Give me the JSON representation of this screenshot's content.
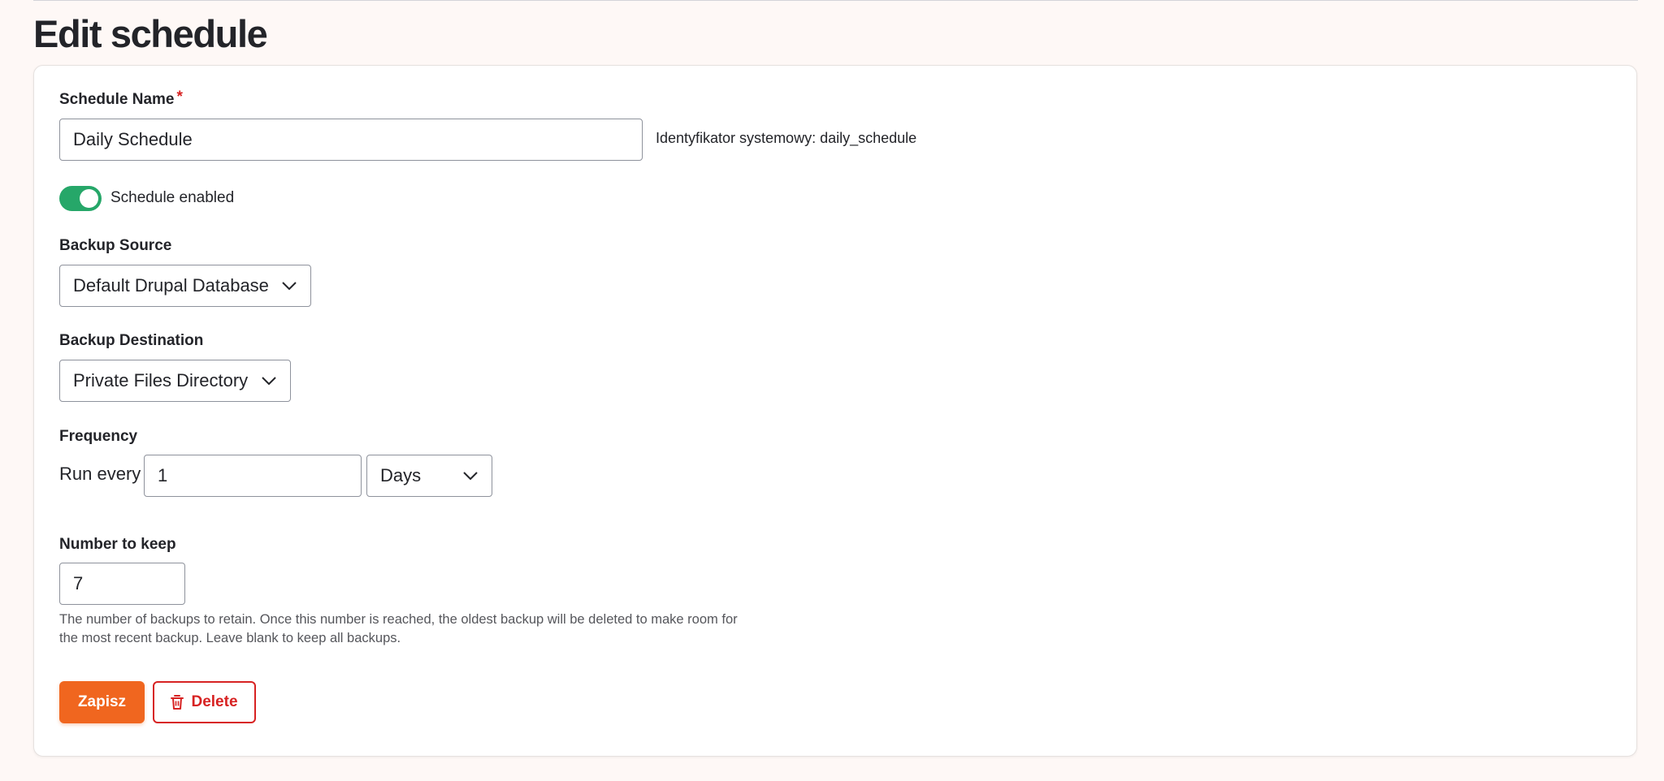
{
  "page": {
    "title": "Edit schedule"
  },
  "form": {
    "schedule_name": {
      "label": "Schedule Name",
      "required_marker": "*",
      "value": "Daily Schedule",
      "machine_name": "Identyfikator systemowy: daily_schedule"
    },
    "enabled": {
      "label": "Schedule enabled",
      "checked": true
    },
    "backup_source": {
      "label": "Backup Source",
      "selected": "Default Drupal Database"
    },
    "backup_destination": {
      "label": "Backup Destination",
      "selected": "Private Files Directory"
    },
    "frequency": {
      "label": "Frequency",
      "prefix": "Run every",
      "value": "1",
      "unit_selected": "Days"
    },
    "number_to_keep": {
      "label": "Number to keep",
      "value": "7",
      "description": "The number of backups to retain. Once this number is reached, the oldest backup will be deleted to make room for the most recent backup. Leave blank to keep all backups."
    }
  },
  "actions": {
    "save_label": "Zapisz",
    "delete_label": "Delete"
  },
  "colors": {
    "primary": "#f0661f",
    "danger": "#d72222",
    "toggle_on": "#26a769",
    "background": "#fef8f6"
  },
  "icons": {
    "select_arrow": "chevron-down-icon",
    "delete": "trash-icon"
  }
}
